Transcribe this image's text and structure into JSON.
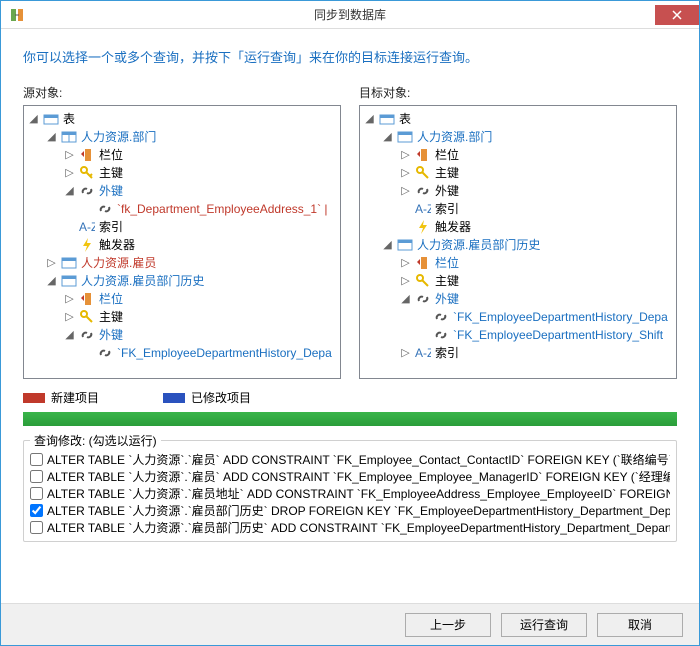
{
  "title": "同步到数据库",
  "hint": "你可以选择一个或多个查询，并按下「运行查询」来在你的目标连接运行查询。",
  "source_label": "源对象:",
  "target_label": "目标对象:",
  "tables_label": "表",
  "src": {
    "dept": "人力资源.部门",
    "cols": "栏位",
    "pk": "主键",
    "fk": "外键",
    "fk_dep_emp": "`fk_Department_EmployeeAddress_1` |",
    "idx": "索引",
    "trig": "触发器",
    "emp": "人力资源.雇员",
    "hist": "人力资源.雇员部门历史",
    "fk_hist": "`FK_EmployeeDepartmentHistory_Depa"
  },
  "tgt": {
    "dept": "人力资源.部门",
    "cols": "栏位",
    "pk": "主键",
    "fk": "外键",
    "idx": "索引",
    "trig": "触发器",
    "hist": "人力资源.雇员部门历史",
    "fk_hist1": "`FK_EmployeeDepartmentHistory_Depa",
    "fk_hist2": "`FK_EmployeeDepartmentHistory_Shift"
  },
  "legend": {
    "new": "新建项目",
    "mod": "已修改项目"
  },
  "queries": {
    "label": "查询修改: (勾选以运行)",
    "rows": [
      {
        "c": false,
        "t": "ALTER TABLE `人力资源`.`雇员` ADD CONSTRAINT `FK_Employee_Contact_ContactID` FOREIGN KEY (`联络编号`) RE"
      },
      {
        "c": false,
        "t": "ALTER TABLE `人力资源`.`雇员` ADD CONSTRAINT `FK_Employee_Employee_ManagerID` FOREIGN KEY (`经理编号"
      },
      {
        "c": false,
        "t": "ALTER TABLE `人力资源`.`雇员地址` ADD CONSTRAINT `FK_EmployeeAddress_Employee_EmployeeID` FOREIGN K"
      },
      {
        "c": true,
        "t": "ALTER TABLE `人力资源`.`雇员部门历史` DROP FOREIGN KEY `FK_EmployeeDepartmentHistory_Department_Depart"
      },
      {
        "c": false,
        "t": "ALTER TABLE `人力资源`.`雇员部门历史` ADD CONSTRAINT `FK_EmployeeDepartmentHistory_Department_Departn"
      }
    ]
  },
  "buttons": {
    "prev": "上一步",
    "run": "运行查询",
    "cancel": "取消"
  }
}
